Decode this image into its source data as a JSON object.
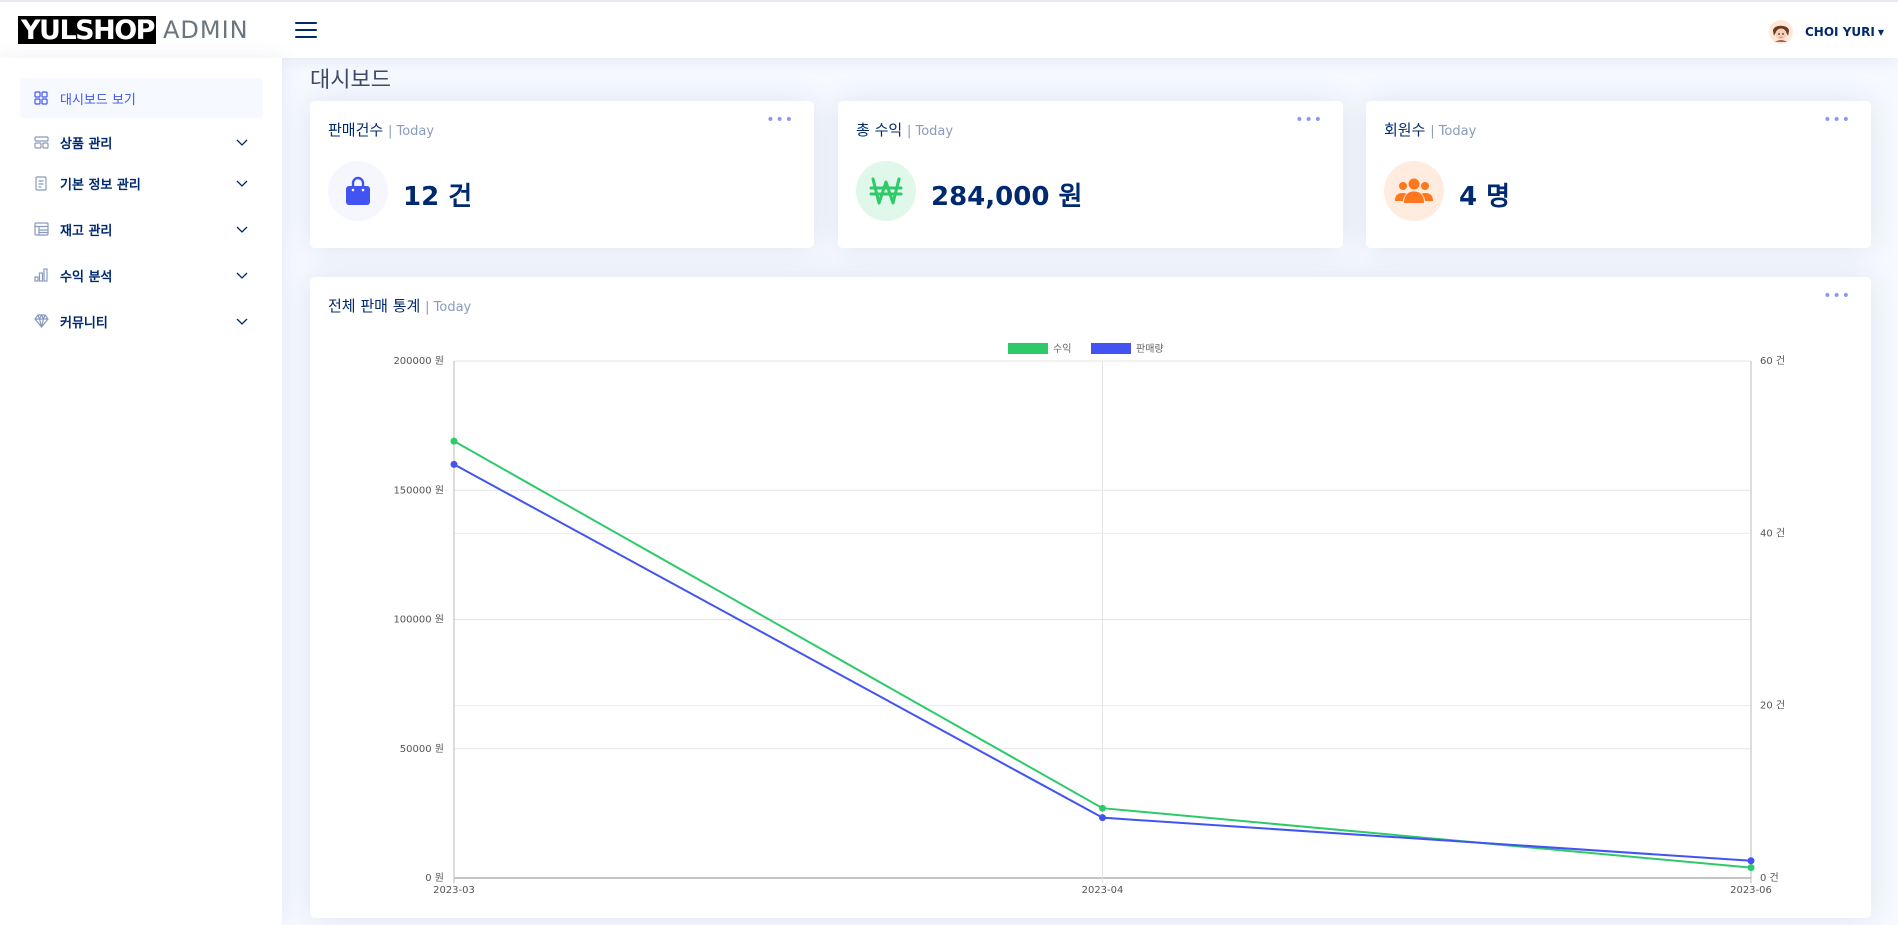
{
  "header": {
    "logo_box": "YULSHOP",
    "logo_text": "ADMIN",
    "user_name": "CHOI YURI"
  },
  "sidebar": {
    "items": [
      {
        "label": "대시보드 보기",
        "icon": "grid-icon"
      },
      {
        "label": "상품 관리",
        "icon": "layout-icon"
      },
      {
        "label": "기본 정보 관리",
        "icon": "document-icon"
      },
      {
        "label": "재고 관리",
        "icon": "table-icon"
      },
      {
        "label": "수익 분석",
        "icon": "bar-chart-icon"
      },
      {
        "label": "커뮤니티",
        "icon": "gem-icon"
      }
    ]
  },
  "page": {
    "title": "대시보드"
  },
  "cards": {
    "sales": {
      "title": "판매건수",
      "sub": "| Today",
      "value": "12 건",
      "icon": "shopping-bag-icon",
      "color": "#4154f1",
      "bg": "#f6f6fe"
    },
    "revenue": {
      "title": "총 수익",
      "sub": "| Today",
      "value": "284,000 원",
      "icon": "won-icon",
      "color": "#2eca6a",
      "bg": "#e0f8e9"
    },
    "members": {
      "title": "회원수",
      "sub": "| Today",
      "value": "4 명",
      "icon": "people-icon",
      "color": "#ff771d",
      "bg": "#ffecdf"
    }
  },
  "chart_card": {
    "title": "전체 판매 통계",
    "sub": "| Today"
  },
  "chart_data": {
    "type": "line",
    "categories": [
      "2023-03",
      "2023-04",
      "2023-06"
    ],
    "series": [
      {
        "name": "수익",
        "axis": "left",
        "color": "#2eca6a",
        "values": [
          169000,
          27000,
          4000
        ]
      },
      {
        "name": "판매량",
        "axis": "right",
        "color": "#4154f1",
        "values": [
          48,
          7,
          2
        ]
      }
    ],
    "y_left": {
      "min": 0,
      "max": 200000,
      "ticks": [
        0,
        50000,
        100000,
        150000,
        200000
      ],
      "suffix": " 원"
    },
    "y_right": {
      "min": 0,
      "max": 60,
      "ticks": [
        0,
        20,
        40,
        60
      ],
      "suffix": " 건"
    },
    "grid": true,
    "legend": "top-center"
  }
}
